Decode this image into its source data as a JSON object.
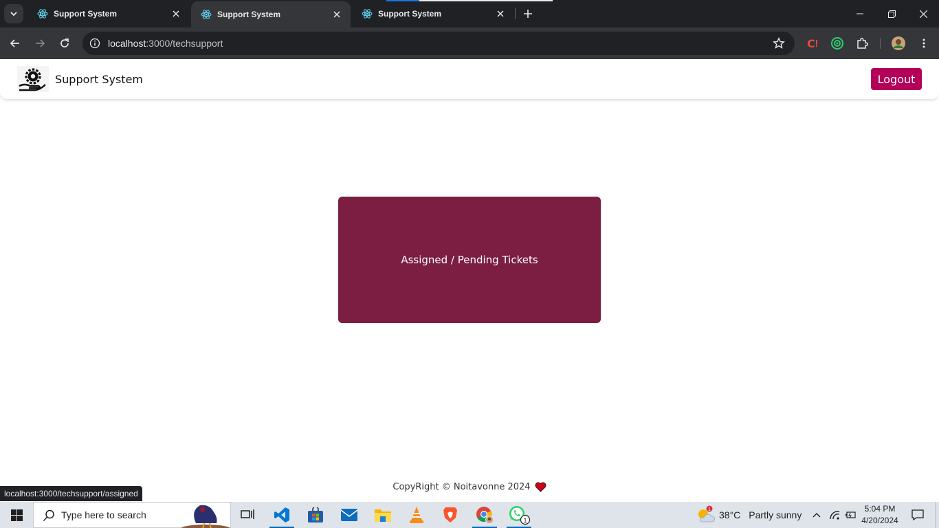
{
  "browser": {
    "tabs": [
      {
        "title": "Support System",
        "active": false
      },
      {
        "title": "Support System",
        "active": true
      },
      {
        "title": "Support System",
        "active": false
      }
    ],
    "url_host": "localhost",
    "url_path": ":3000/techsupport",
    "status_url": "localhost:3000/techsupport/assigned"
  },
  "navbar": {
    "brand": "Support System",
    "logout_label": "Logout"
  },
  "main": {
    "card_label": "Assigned / Pending Tickets"
  },
  "footer": {
    "text": "CopyRight © Noitavonne 2024"
  },
  "taskbar": {
    "search_placeholder": "Type here to search",
    "weather_temp": "38°C",
    "weather_desc": "Partly sunny",
    "weather_badge": "1",
    "whatsapp_badge": "1",
    "time": "5:04 PM",
    "date": "4/20/2024"
  },
  "colors": {
    "accent": "#b30059",
    "card": "#7b1e42",
    "chrome_dark": "#202124",
    "chrome_mid": "#35363a"
  }
}
